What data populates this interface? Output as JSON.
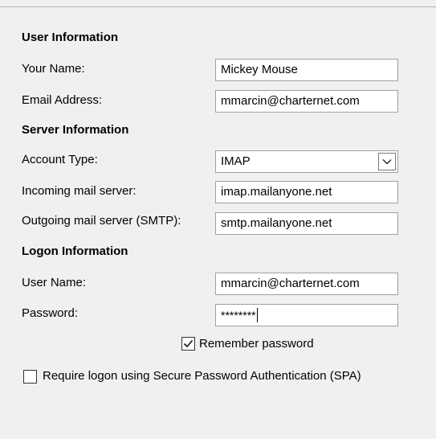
{
  "user_info": {
    "title": "User Information",
    "your_name_label": "Your Name:",
    "your_name_value": "Mickey Mouse",
    "email_label": "Email Address:",
    "email_value": "mmarcin@charternet.com"
  },
  "server_info": {
    "title": "Server Information",
    "account_type_label": "Account Type:",
    "account_type_value": "IMAP",
    "incoming_label": "Incoming mail server:",
    "incoming_value": "imap.mailanyone.net",
    "outgoing_label": "Outgoing mail server (SMTP):",
    "outgoing_value": "smtp.mailanyone.net"
  },
  "logon_info": {
    "title": "Logon Information",
    "username_label": "User Name:",
    "username_value": "mmarcin@charternet.com",
    "password_label": "Password:",
    "password_value": "********",
    "remember_label": "Remember password",
    "remember_checked": true,
    "spa_label": "Require logon using Secure Password Authentication (SPA)",
    "spa_checked": false
  }
}
